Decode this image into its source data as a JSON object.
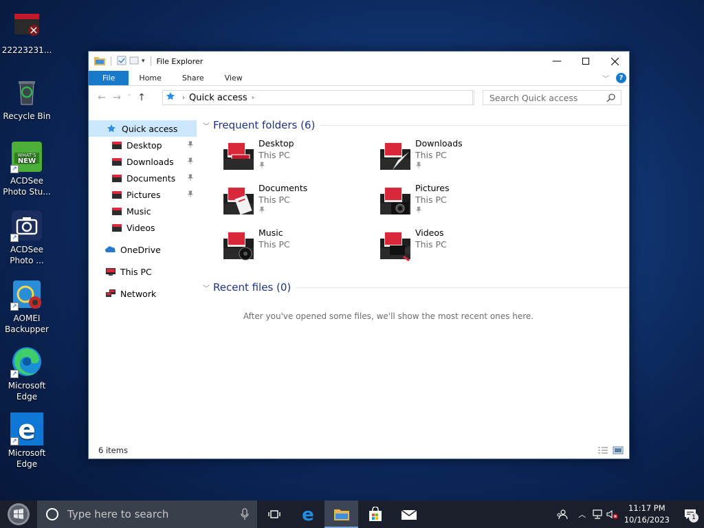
{
  "desktop": {
    "icons": [
      {
        "label": "22223231..."
      },
      {
        "label": "Recycle Bin"
      },
      {
        "label": "ACDSee Photo Stu..."
      },
      {
        "label": "ACDSee Photo ..."
      },
      {
        "label": "AOMEI Backupper"
      },
      {
        "label": "Microsoft Edge"
      },
      {
        "label": "Microsoft Edge"
      }
    ]
  },
  "window": {
    "title": "File Explorer",
    "ribbon_tabs": [
      "File",
      "Home",
      "Share",
      "View"
    ],
    "help_label": "?",
    "address": {
      "location": "Quick access",
      "search_placeholder": "Search Quick access"
    },
    "nav": {
      "quick_access": "Quick access",
      "items": [
        "Desktop",
        "Downloads",
        "Documents",
        "Pictures",
        "Music",
        "Videos"
      ],
      "onedrive": "OneDrive",
      "this_pc": "This PC",
      "network": "Network"
    },
    "frequent": {
      "heading": "Frequent folders (6)",
      "folders": [
        {
          "name": "Desktop",
          "location": "This PC"
        },
        {
          "name": "Downloads",
          "location": "This PC"
        },
        {
          "name": "Documents",
          "location": "This PC"
        },
        {
          "name": "Pictures",
          "location": "This PC"
        },
        {
          "name": "Music",
          "location": "This PC"
        },
        {
          "name": "Videos",
          "location": "This PC"
        }
      ]
    },
    "recent": {
      "heading": "Recent files (0)",
      "empty_message": "After you've opened some files, we'll show the most recent ones here."
    },
    "status": "6 items"
  },
  "taskbar": {
    "search_placeholder": "Type here to search",
    "time": "11:17 PM",
    "date": "10/16/2023",
    "notification_count": "1"
  },
  "colors": {
    "accent": "#1979ca",
    "selection": "#cce8ff",
    "heading": "#1e3287",
    "folder_red": "#d8283a"
  }
}
